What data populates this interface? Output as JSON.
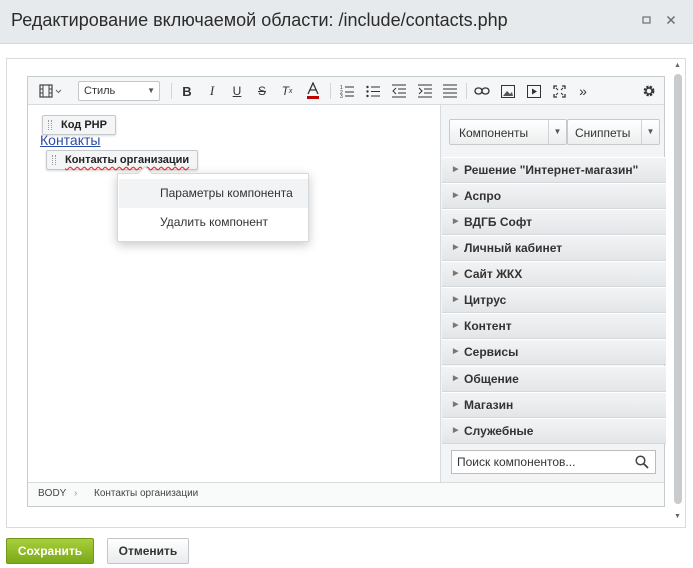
{
  "window": {
    "title": "Редактирование включаемой области: /include/contacts.php",
    "minimize_icon": "minimize-icon",
    "close_icon": "close-icon"
  },
  "toolbar": {
    "style_select_value": "Стиль",
    "icons": [
      "source-view-icon",
      "bold-icon",
      "italic-icon",
      "underline-icon",
      "strikethrough-icon",
      "remove-format-icon",
      "text-color-icon",
      "ordered-list-icon",
      "unordered-list-icon",
      "outdent-icon",
      "indent-icon",
      "align-icon",
      "link-icon",
      "image-icon",
      "video-icon",
      "fullscreen-icon",
      "more-icon",
      "settings-icon"
    ],
    "text_color_accent": "#c00000"
  },
  "content": {
    "php_chip": "Код PHP",
    "link_text": "Контакты",
    "component_chip": "Контакты организации"
  },
  "context_menu": {
    "items": [
      "Параметры компонента",
      "Удалить компонент"
    ]
  },
  "statusbar": {
    "path_root": "BODY",
    "path_item": "Контакты организации"
  },
  "panel": {
    "components_button": "Компоненты",
    "snippets_button": "Сниппеты",
    "categories": [
      "Решение \"Интернет-магазин\"",
      "Аспро",
      "ВДГБ Софт",
      "Личный кабинет",
      "Сайт ЖКХ",
      "Цитрус",
      "Контент",
      "Сервисы",
      "Общение",
      "Магазин",
      "Служебные"
    ],
    "search_placeholder": "Поиск компонентов..."
  },
  "footer": {
    "save_label": "Сохранить",
    "cancel_label": "Отменить",
    "save_color": "#8cbf26"
  }
}
